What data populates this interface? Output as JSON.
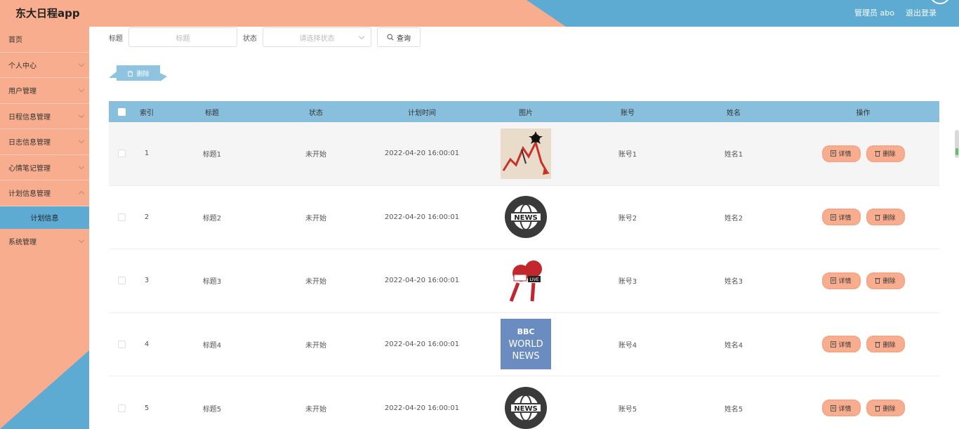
{
  "app": {
    "title": "东大日程app"
  },
  "header": {
    "user": "管理员 abo",
    "logout": "退出登录"
  },
  "sidebar": {
    "items": [
      {
        "label": "首页",
        "has_arrow": false
      },
      {
        "label": "个人中心",
        "has_arrow": true
      },
      {
        "label": "用户管理",
        "has_arrow": true
      },
      {
        "label": "日程信息管理",
        "has_arrow": true
      },
      {
        "label": "日志信息管理",
        "has_arrow": true
      },
      {
        "label": "心情笔记管理",
        "has_arrow": true
      },
      {
        "label": "计划信息管理",
        "has_arrow": true,
        "expanded": true
      },
      {
        "label": "系统管理",
        "has_arrow": true
      }
    ],
    "active_sub": "计划信息"
  },
  "search": {
    "title_label": "标题",
    "title_placeholder": "标题",
    "status_label": "状态",
    "status_placeholder": "请选择状态",
    "query_button": "查询"
  },
  "batch_delete": "删除",
  "table": {
    "headers": [
      "索引",
      "标题",
      "状态",
      "计划时间",
      "图片",
      "账号",
      "姓名",
      "操作"
    ],
    "detail_label": "详情",
    "delete_label": "删除",
    "rows": [
      {
        "idx": "1",
        "title": "标题1",
        "status": "未开始",
        "time": "2022-04-20 16:00:01",
        "image": "stock-chart-illustration",
        "account": "账号1",
        "name": "姓名1"
      },
      {
        "idx": "2",
        "title": "标题2",
        "status": "未开始",
        "time": "2022-04-20 16:00:01",
        "image": "news-globe-badge",
        "account": "账号2",
        "name": "姓名2"
      },
      {
        "idx": "3",
        "title": "标题3",
        "status": "未开始",
        "time": "2022-04-20 16:00:01",
        "image": "news-microphones",
        "account": "账号3",
        "name": "姓名3"
      },
      {
        "idx": "4",
        "title": "标题4",
        "status": "未开始",
        "time": "2022-04-20 16:00:01",
        "image": "bbc-world-news-logo",
        "account": "账号4",
        "name": "姓名4"
      },
      {
        "idx": "5",
        "title": "标题5",
        "status": "未开始",
        "time": "2022-04-20 16:00:01",
        "image": "news-globe-badge",
        "account": "账号5",
        "name": "姓名5"
      }
    ]
  },
  "logos": {
    "news_badge": "NEWS",
    "live_tag": "LIVE",
    "bbc_line1": "BBC",
    "bbc_line2": "WORLD",
    "bbc_line3": "NEWS"
  },
  "colors": {
    "salmon": "#f8ad8f",
    "blue": "#5daad2",
    "table_header": "#87bfdc"
  }
}
